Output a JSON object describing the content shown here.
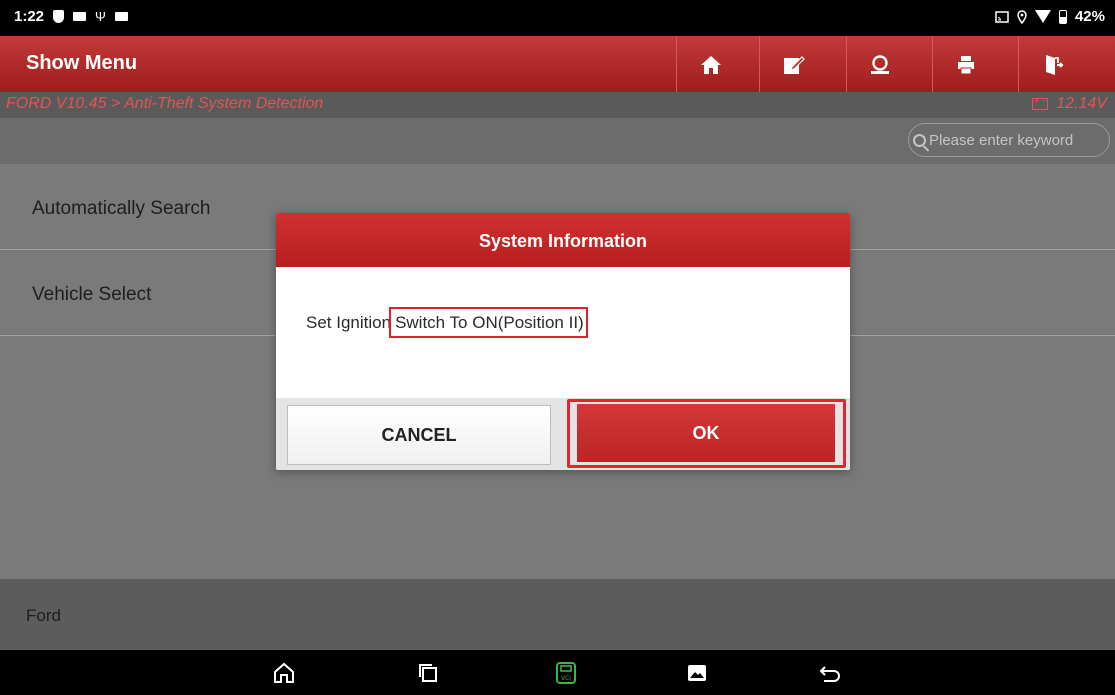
{
  "status_bar": {
    "time": "1:22",
    "battery": "42%"
  },
  "title_bar": {
    "title": "Show Menu",
    "buttons": [
      "home-icon",
      "edit-report-icon",
      "user-icon",
      "print-icon",
      "exit-icon"
    ]
  },
  "path_bar": {
    "breadcrumb": "FORD V10.45 > Anti-Theft System Detection",
    "voltage": "12.14V"
  },
  "search": {
    "placeholder": "Please enter keyword"
  },
  "menu": {
    "items": [
      {
        "label": "Automatically Search"
      },
      {
        "label": "Vehicle Select"
      }
    ]
  },
  "footer": {
    "label": "Ford"
  },
  "dialog": {
    "title": "System Information",
    "message_prefix": "Set Ignition",
    "message_highlight": "Switch To ON(Position II)",
    "cancel_label": "CANCEL",
    "ok_label": "OK"
  },
  "nav_bar": {
    "buttons": [
      "home-outline-icon",
      "recents-icon",
      "vci-icon",
      "gallery-icon",
      "back-icon"
    ]
  },
  "colors": {
    "brand_red": "#b81e1e",
    "highlight_red": "#e8232c",
    "vci_green": "#39b54a",
    "path_red": "#e05555"
  }
}
